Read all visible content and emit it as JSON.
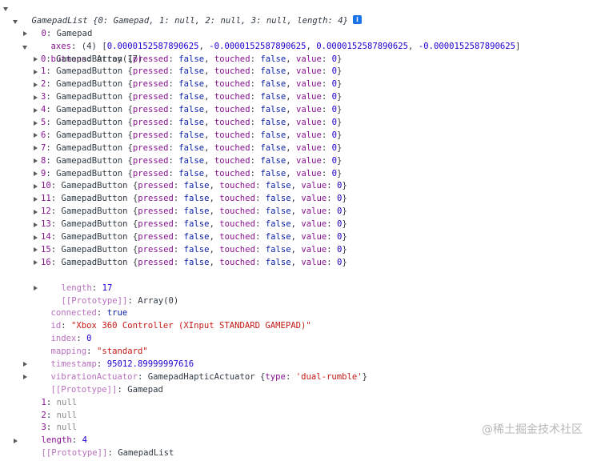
{
  "header": {
    "name": "GamepadList",
    "preview": "{0: Gamepad, 1: null, 2: null, 3: null, length: 4}",
    "info_icon": "i"
  },
  "gamepad": {
    "key": "0",
    "type": "Gamepad",
    "axes": {
      "key": "axes",
      "count": "(4)",
      "values": [
        "0.0000152587890625",
        "-0.0000152587890625",
        "0.0000152587890625",
        "-0.0000152587890625"
      ]
    },
    "buttons": {
      "key": "buttons",
      "type": "Array(17)",
      "items": [
        {
          "index": "0",
          "type": "GamepadButton",
          "pressed": "false",
          "touched": "false",
          "value": "0"
        },
        {
          "index": "1",
          "type": "GamepadButton",
          "pressed": "false",
          "touched": "false",
          "value": "0"
        },
        {
          "index": "2",
          "type": "GamepadButton",
          "pressed": "false",
          "touched": "false",
          "value": "0"
        },
        {
          "index": "3",
          "type": "GamepadButton",
          "pressed": "false",
          "touched": "false",
          "value": "0"
        },
        {
          "index": "4",
          "type": "GamepadButton",
          "pressed": "false",
          "touched": "false",
          "value": "0"
        },
        {
          "index": "5",
          "type": "GamepadButton",
          "pressed": "false",
          "touched": "false",
          "value": "0"
        },
        {
          "index": "6",
          "type": "GamepadButton",
          "pressed": "false",
          "touched": "false",
          "value": "0"
        },
        {
          "index": "7",
          "type": "GamepadButton",
          "pressed": "false",
          "touched": "false",
          "value": "0"
        },
        {
          "index": "8",
          "type": "GamepadButton",
          "pressed": "false",
          "touched": "false",
          "value": "0"
        },
        {
          "index": "9",
          "type": "GamepadButton",
          "pressed": "false",
          "touched": "false",
          "value": "0"
        },
        {
          "index": "10",
          "type": "GamepadButton",
          "pressed": "false",
          "touched": "false",
          "value": "0"
        },
        {
          "index": "11",
          "type": "GamepadButton",
          "pressed": "false",
          "touched": "false",
          "value": "0"
        },
        {
          "index": "12",
          "type": "GamepadButton",
          "pressed": "false",
          "touched": "false",
          "value": "0"
        },
        {
          "index": "13",
          "type": "GamepadButton",
          "pressed": "false",
          "touched": "false",
          "value": "0"
        },
        {
          "index": "14",
          "type": "GamepadButton",
          "pressed": "false",
          "touched": "false",
          "value": "0"
        },
        {
          "index": "15",
          "type": "GamepadButton",
          "pressed": "false",
          "touched": "false",
          "value": "0"
        },
        {
          "index": "16",
          "type": "GamepadButton",
          "pressed": "false",
          "touched": "false",
          "value": "0"
        }
      ],
      "length_key": "length",
      "length_value": "17",
      "proto_key": "[[Prototype]]",
      "proto_value": "Array(0)"
    },
    "connected": {
      "key": "connected",
      "value": "true"
    },
    "id": {
      "key": "id",
      "value": "\"Xbox 360 Controller (XInput STANDARD GAMEPAD)\""
    },
    "index": {
      "key": "index",
      "value": "0"
    },
    "mapping": {
      "key": "mapping",
      "value": "\"standard\""
    },
    "timestamp": {
      "key": "timestamp",
      "value": "95012.89999997616"
    },
    "vibration": {
      "key": "vibrationActuator",
      "type": "GamepadHapticActuator",
      "type_key": "type",
      "type_value": "'dual-rumble'"
    },
    "proto": {
      "key": "[[Prototype]]",
      "value": "Gamepad"
    }
  },
  "others": [
    {
      "key": "1",
      "value": "null"
    },
    {
      "key": "2",
      "value": "null"
    },
    {
      "key": "3",
      "value": "null"
    }
  ],
  "length": {
    "key": "length",
    "value": "4"
  },
  "list_proto": {
    "key": "[[Prototype]]",
    "value": "GamepadList"
  },
  "watermark": "@稀土掘金技术社区"
}
